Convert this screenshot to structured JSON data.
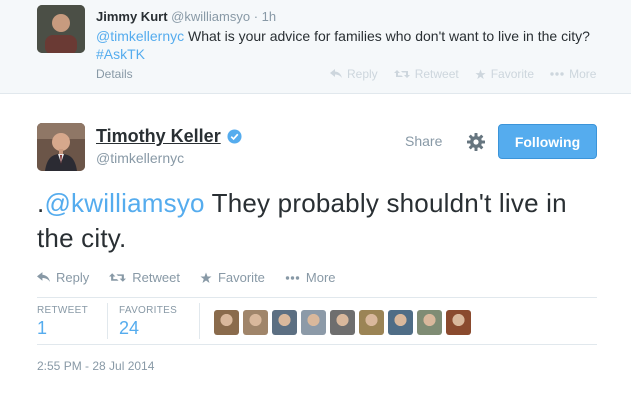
{
  "reply_tweet": {
    "name": "Jimmy Kurt",
    "handle": "@kwilliamsyo",
    "time": "· 1h",
    "text_mention": "@timkellernyc",
    "text_body": " What is your advice for families who don't want to live in the city? ",
    "text_hashtag": "#AskTK",
    "details_label": "Details",
    "actions": {
      "reply": "Reply",
      "retweet": "Retweet",
      "favorite": "Favorite",
      "more": "More"
    }
  },
  "main_tweet": {
    "name": "Timothy Keller",
    "handle": "@timkellernyc",
    "share_label": "Share",
    "follow_label": "Following",
    "text_prefix": ".",
    "text_mention": "@kwilliamsyo",
    "text_body": " They probably shouldn't live in the city.",
    "actions": {
      "reply": "Reply",
      "retweet": "Retweet",
      "favorite": "Favorite",
      "more": "More"
    },
    "stats": {
      "retweets_label": "RETWEET",
      "retweets_value": "1",
      "favorites_label": "FAVORITES",
      "favorites_value": "24"
    },
    "timestamp": "2:55 PM - 28 Jul 2014"
  },
  "colors": {
    "accent": "#55acee",
    "follow_button": "#55acee",
    "muted_text": "#8899a6",
    "reply_background": "#f5f8fa"
  },
  "favoriter_avatars": [
    {
      "color": "#8a6b4c"
    },
    {
      "color": "#a0856a"
    },
    {
      "color": "#5c6f82"
    },
    {
      "color": "#8c9aa8"
    },
    {
      "color": "#6e6e6e"
    },
    {
      "color": "#9b8455"
    },
    {
      "color": "#4f6d86"
    },
    {
      "color": "#7f8c74"
    },
    {
      "color": "#8a4a2e"
    }
  ]
}
